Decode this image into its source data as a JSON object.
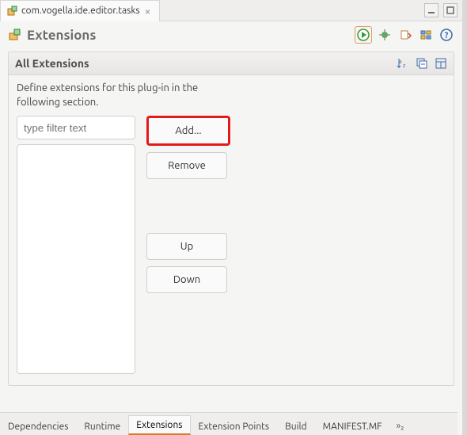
{
  "tab": {
    "label": "com.vogella.ide.editor.tasks"
  },
  "header": {
    "title": "Extensions"
  },
  "section": {
    "title": "All Extensions",
    "description": "Define extensions for this plug-in in the following section."
  },
  "filter": {
    "placeholder": "type filter text"
  },
  "buttons": {
    "add": "Add...",
    "remove": "Remove",
    "up": "Up",
    "down": "Down"
  },
  "bottomTabs": {
    "dependencies": "Dependencies",
    "runtime": "Runtime",
    "extensions": "Extensions",
    "extensionPoints": "Extension Points",
    "build": "Build",
    "manifest": "MANIFEST.MF",
    "more": "»₂"
  }
}
